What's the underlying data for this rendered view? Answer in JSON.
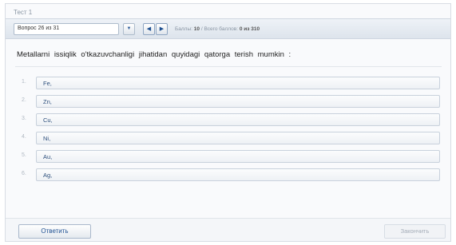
{
  "window": {
    "title": "Тест 1"
  },
  "toolbar": {
    "question_select": "Вопрос 26 из 31",
    "dropdown_arrow": "▼",
    "prev_label": "◀",
    "next_label": "▶",
    "score_label": "Баллы:",
    "score_value": "10",
    "score_sep": "/",
    "total_label": "Всего баллов:",
    "total_value": "0 из 310"
  },
  "question": {
    "text": "Metallarni issiqlik o'tkazuvchanligi jihatidan quyidagi qatorga terish mumkin :"
  },
  "answers": [
    {
      "num": "1.",
      "label": "Fe,"
    },
    {
      "num": "2.",
      "label": "Zn,"
    },
    {
      "num": "3.",
      "label": "Cu,"
    },
    {
      "num": "4.",
      "label": "Ni,"
    },
    {
      "num": "5.",
      "label": "Au,"
    },
    {
      "num": "6.",
      "label": "Ag,"
    }
  ],
  "footer": {
    "submit_label": "Ответить",
    "finish_label": "Закончить"
  },
  "colors": {
    "accent": "#1d4f91",
    "border": "#c8d1dc",
    "toolbar_bg": "#dde4ec"
  }
}
